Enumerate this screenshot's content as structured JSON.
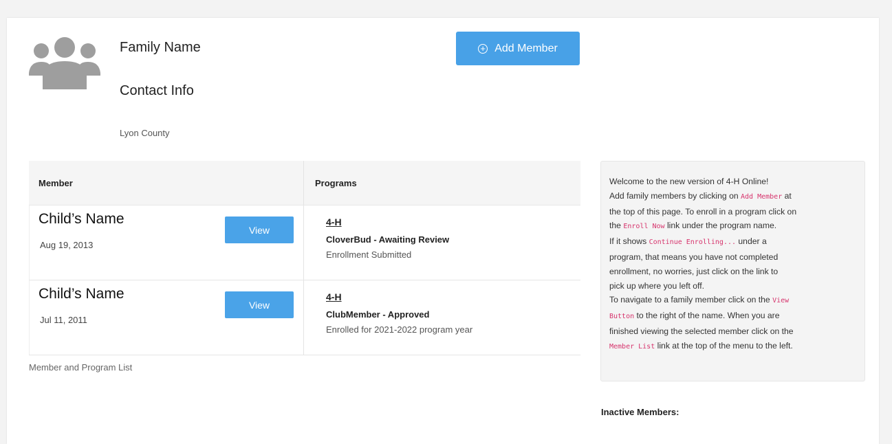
{
  "header": {
    "family_name": "Family Name",
    "contact_info": "Contact Info",
    "county": "Lyon County",
    "avatar_icon": "family-group-icon",
    "add_member_label": "Add Member",
    "add_member_icon": "plus-circle-icon"
  },
  "colors": {
    "accent": "#48a1e7",
    "code_pink": "#d6336c",
    "avatar_gray": "#9e9e9e"
  },
  "table": {
    "columns": [
      "Member",
      "Programs"
    ],
    "rows": [
      {
        "name": "Child’s Name",
        "dob": "Aug 19, 2013",
        "view_label": "View",
        "program": "4-H",
        "status": "CloverBud - Awaiting Review",
        "detail": "Enrollment Submitted"
      },
      {
        "name": "Child’s Name",
        "dob": "Jul 11, 2011",
        "view_label": "View",
        "program": "4-H",
        "status": "ClubMember - Approved",
        "detail": "Enrolled for 2021-2022 program year"
      }
    ],
    "caption": "Member and Program List"
  },
  "info": {
    "l1": "Welcome to the new version of 4-H Online!",
    "l2a": "Add family members by clicking on ",
    "l2code": "Add Member",
    "l2b": " at",
    "l3": "the top of this page. To enroll in a program click on",
    "l4a": "the ",
    "l4code": "Enroll Now",
    "l4b": " link under the program name.",
    "l5a": "If it shows ",
    "l5code": "Continue Enrolling...",
    "l5b": " under a",
    "l6": "program, that means you have not completed",
    "l7": "enrollment, no worries, just click on the link to",
    "l8": "pick up where you left off.",
    "l9a": "To navigate to a family member click on the ",
    "l9code": "View",
    "l10code": "Button",
    "l10b": " to the right of the name. When you are",
    "l11": "finished viewing the selected member click on the",
    "l12code": "Member List",
    "l12b": " link at the top of the menu to the left."
  },
  "inactive_label": "Inactive Members:"
}
